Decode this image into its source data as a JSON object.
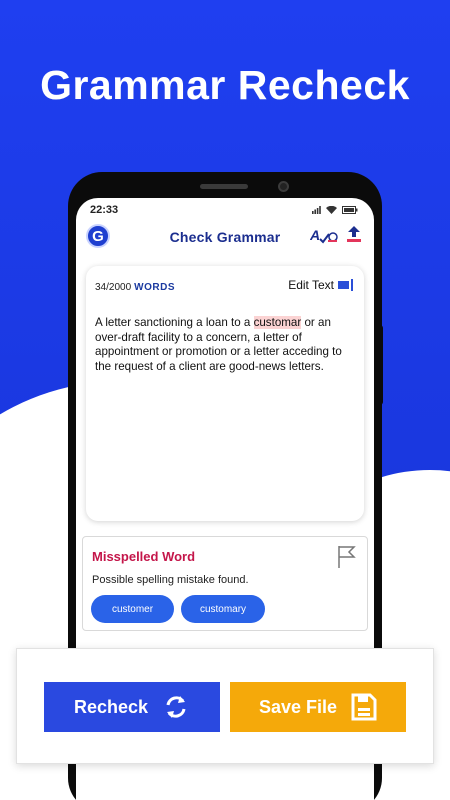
{
  "headline": "Grammar Recheck",
  "status_bar": {
    "time": "22:33"
  },
  "app": {
    "logo_letter": "G",
    "title": "Check Grammar",
    "abc_icon_text": "A"
  },
  "editor": {
    "word_count": "34/2000",
    "word_label": "WORDS",
    "edit_label": "Edit Text",
    "text_before": "A letter sanctioning a loan to a ",
    "misspelled": "customar",
    "text_after": " or an over-draft facility to a concern, a letter of appointment or promotion or a letter acceding to the request of a client are good-news letters."
  },
  "misspelled_card": {
    "title": "Misspelled Word",
    "description": "Possible spelling mistake found.",
    "suggestions": [
      "customer",
      "customary"
    ]
  },
  "actions": {
    "recheck_label": "Recheck",
    "save_label": "Save File"
  },
  "colors": {
    "background_blue": "#1f3ff0",
    "title_navy": "#1b2e8f",
    "error_red": "#c4164a",
    "suggestion_blue": "#2a63e8",
    "recheck_blue": "#2a49e0",
    "save_orange": "#f5a90a",
    "highlight_pink": "#fbd3d3"
  },
  "icons": [
    "refresh-icon",
    "save-file-icon",
    "flag-icon",
    "edit-text-icon",
    "upload-icon",
    "spell-check-icon",
    "wifi-icon",
    "signal-icon",
    "battery-icon"
  ]
}
